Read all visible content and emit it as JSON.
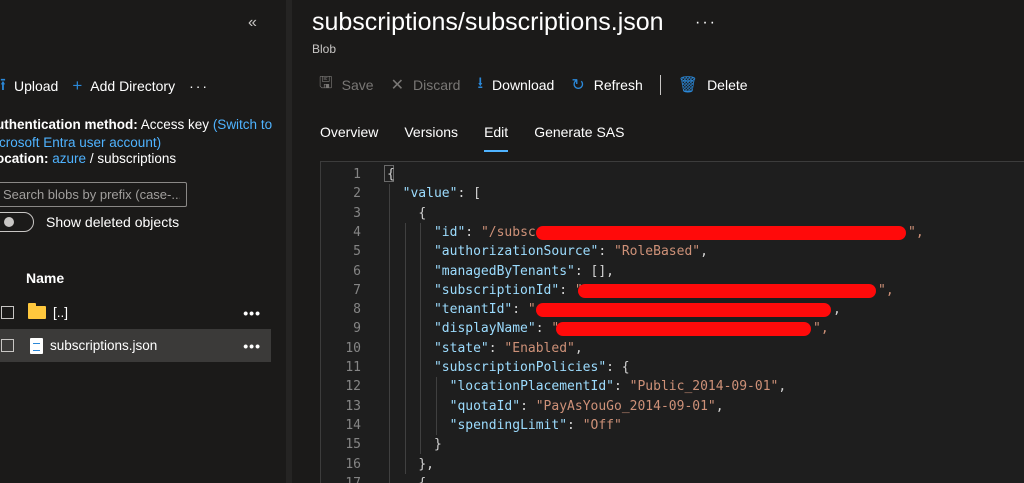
{
  "sidebar": {
    "collapse_icon": "«",
    "toolbar": {
      "upload": "Upload",
      "add_directory": "Add Directory",
      "more": "···"
    },
    "auth_label": "uthentication method:",
    "auth_value": "Access key",
    "auth_link_open": "(Switch to",
    "auth_link_rest": "icrosoft Entra user account)",
    "location_label": "ocation:",
    "location_link": "azure",
    "location_rest": "/ subscriptions",
    "search_placeholder": "Search blobs by prefix (case-...",
    "show_deleted": "Show deleted objects",
    "column_name": "Name",
    "files": [
      {
        "name": "[..]",
        "type": "folder"
      },
      {
        "name": "subscriptions.json",
        "type": "file"
      }
    ],
    "row_more": "•••"
  },
  "header": {
    "title": "subscriptions/subscriptions.json",
    "more": "···",
    "subtitle": "Blob"
  },
  "toolbar": {
    "save": "Save",
    "discard": "Discard",
    "download": "Download",
    "refresh": "Refresh",
    "delete": "Delete"
  },
  "tabs": [
    {
      "label": "Overview",
      "active": false
    },
    {
      "label": "Versions",
      "active": false
    },
    {
      "label": "Edit",
      "active": true
    },
    {
      "label": "Generate SAS",
      "active": false
    }
  ],
  "editor": {
    "lines": [
      {
        "n": "1",
        "t": "{"
      },
      {
        "n": "2",
        "t": "\"value\": ["
      },
      {
        "n": "3",
        "t": "{"
      },
      {
        "n": "4",
        "t": "\"id\": \"/subscriptions/"
      },
      {
        "n": "5",
        "t": "\"authorizationSource\": \"RoleBased\","
      },
      {
        "n": "6",
        "t": "\"managedByTenants\": [],"
      },
      {
        "n": "7",
        "t": "\"subscriptionId\": \""
      },
      {
        "n": "8",
        "t": "\"tenantId\": \""
      },
      {
        "n": "9",
        "t": "\"displayName\": \""
      },
      {
        "n": "10",
        "t": "\"state\": \"Enabled\","
      },
      {
        "n": "11",
        "t": "\"subscriptionPolicies\": {"
      },
      {
        "n": "12",
        "t": "\"locationPlacementId\": \"Public_2014-09-01\","
      },
      {
        "n": "13",
        "t": "\"quotaId\": \"PayAsYouGo_2014-09-01\","
      },
      {
        "n": "14",
        "t": "\"spendingLimit\": \"Off\""
      },
      {
        "n": "15",
        "t": "}"
      },
      {
        "n": "16",
        "t": "},"
      },
      {
        "n": "17",
        "t": "{"
      }
    ]
  },
  "colors": {
    "background": "#1b1a19",
    "accent": "#4fb3ff",
    "json_key": "#9cdcfe",
    "json_string": "#ce9178",
    "redaction": "#ff0a0a"
  }
}
